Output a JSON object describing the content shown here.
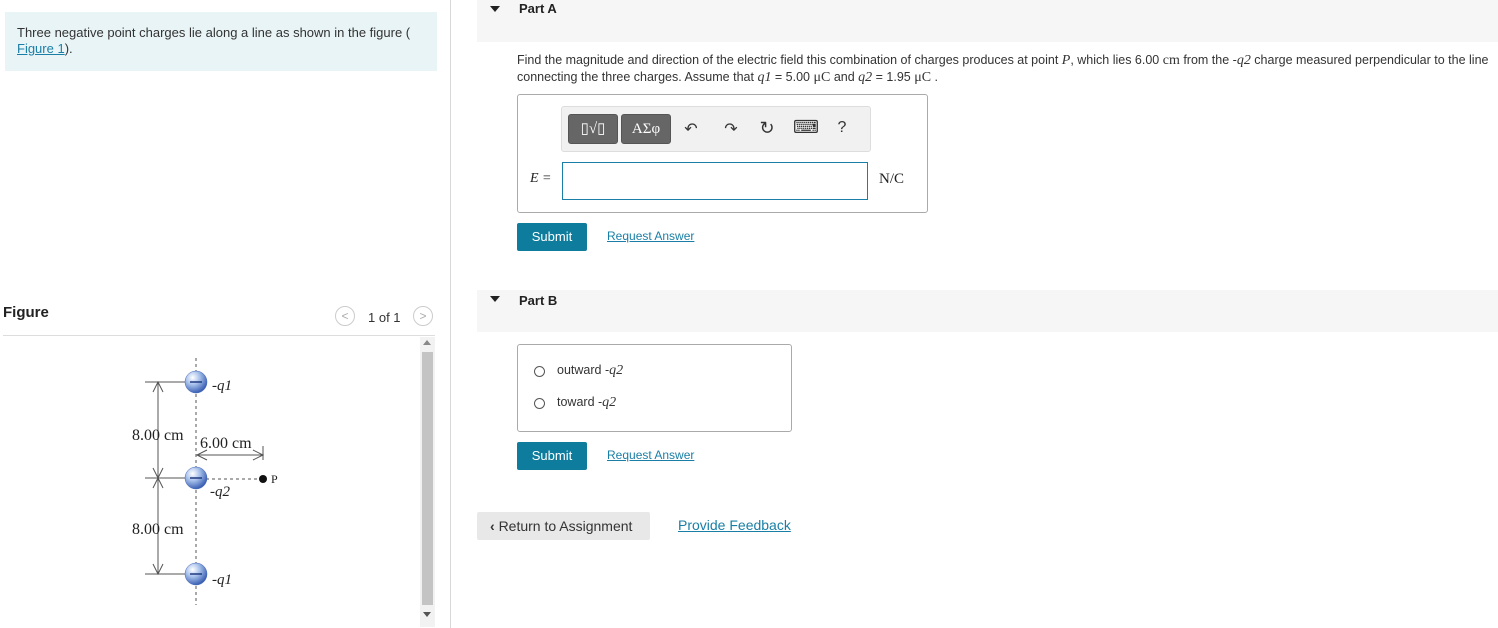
{
  "intro": {
    "text": "Three negative point charges lie along a line as shown in the figure (",
    "link": "Figure 1",
    "text_after": ")."
  },
  "figure_panel": {
    "label": "Figure",
    "pager": "1 of 1",
    "labels": {
      "q1_top": "-q1",
      "q2": "-q2",
      "q1_bottom": "-q1",
      "dist_top": "8.00 cm",
      "dist_bottom": "8.00 cm",
      "dist_horizontal": "6.00 cm",
      "point": "P"
    }
  },
  "part_a": {
    "title": "Part A",
    "question_prefix": "Find the magnitude and direction of the electric field this combination of charges produces at point ",
    "question_point": "P",
    "question_middle": ", which lies 6.00 ",
    "question_unit_cm": "cm",
    "question_middle2": " from the -",
    "question_q2": "q2",
    "question_middle3": " charge measured perpendicular to the line connecting the three charges. Assume that ",
    "question_q1_eq": "q1",
    "question_q1_val": " = 5.00 ",
    "question_unit_mu1": "μC",
    "question_and": " and ",
    "question_q2_eq": "q2",
    "question_q2_val": " = 1.95 ",
    "question_unit_mu2": "μC",
    "question_end": " .",
    "toolbar": {
      "templates_label": "▯√▯",
      "greek_label": "ΑΣφ",
      "undo": "↶",
      "redo": "↷",
      "reset": "↻",
      "keyboard": "⌨",
      "help": "?"
    },
    "variable_label": "E =",
    "input_value": "",
    "unit": "N/C",
    "submit": "Submit",
    "request": "Request Answer"
  },
  "part_b": {
    "title": "Part B",
    "options": [
      {
        "label": "outward -",
        "var": "q2"
      },
      {
        "label": "toward -",
        "var": "q2"
      }
    ],
    "submit": "Submit",
    "request": "Request Answer"
  },
  "footer": {
    "return": "Return to Assignment",
    "feedback": "Provide Feedback"
  }
}
